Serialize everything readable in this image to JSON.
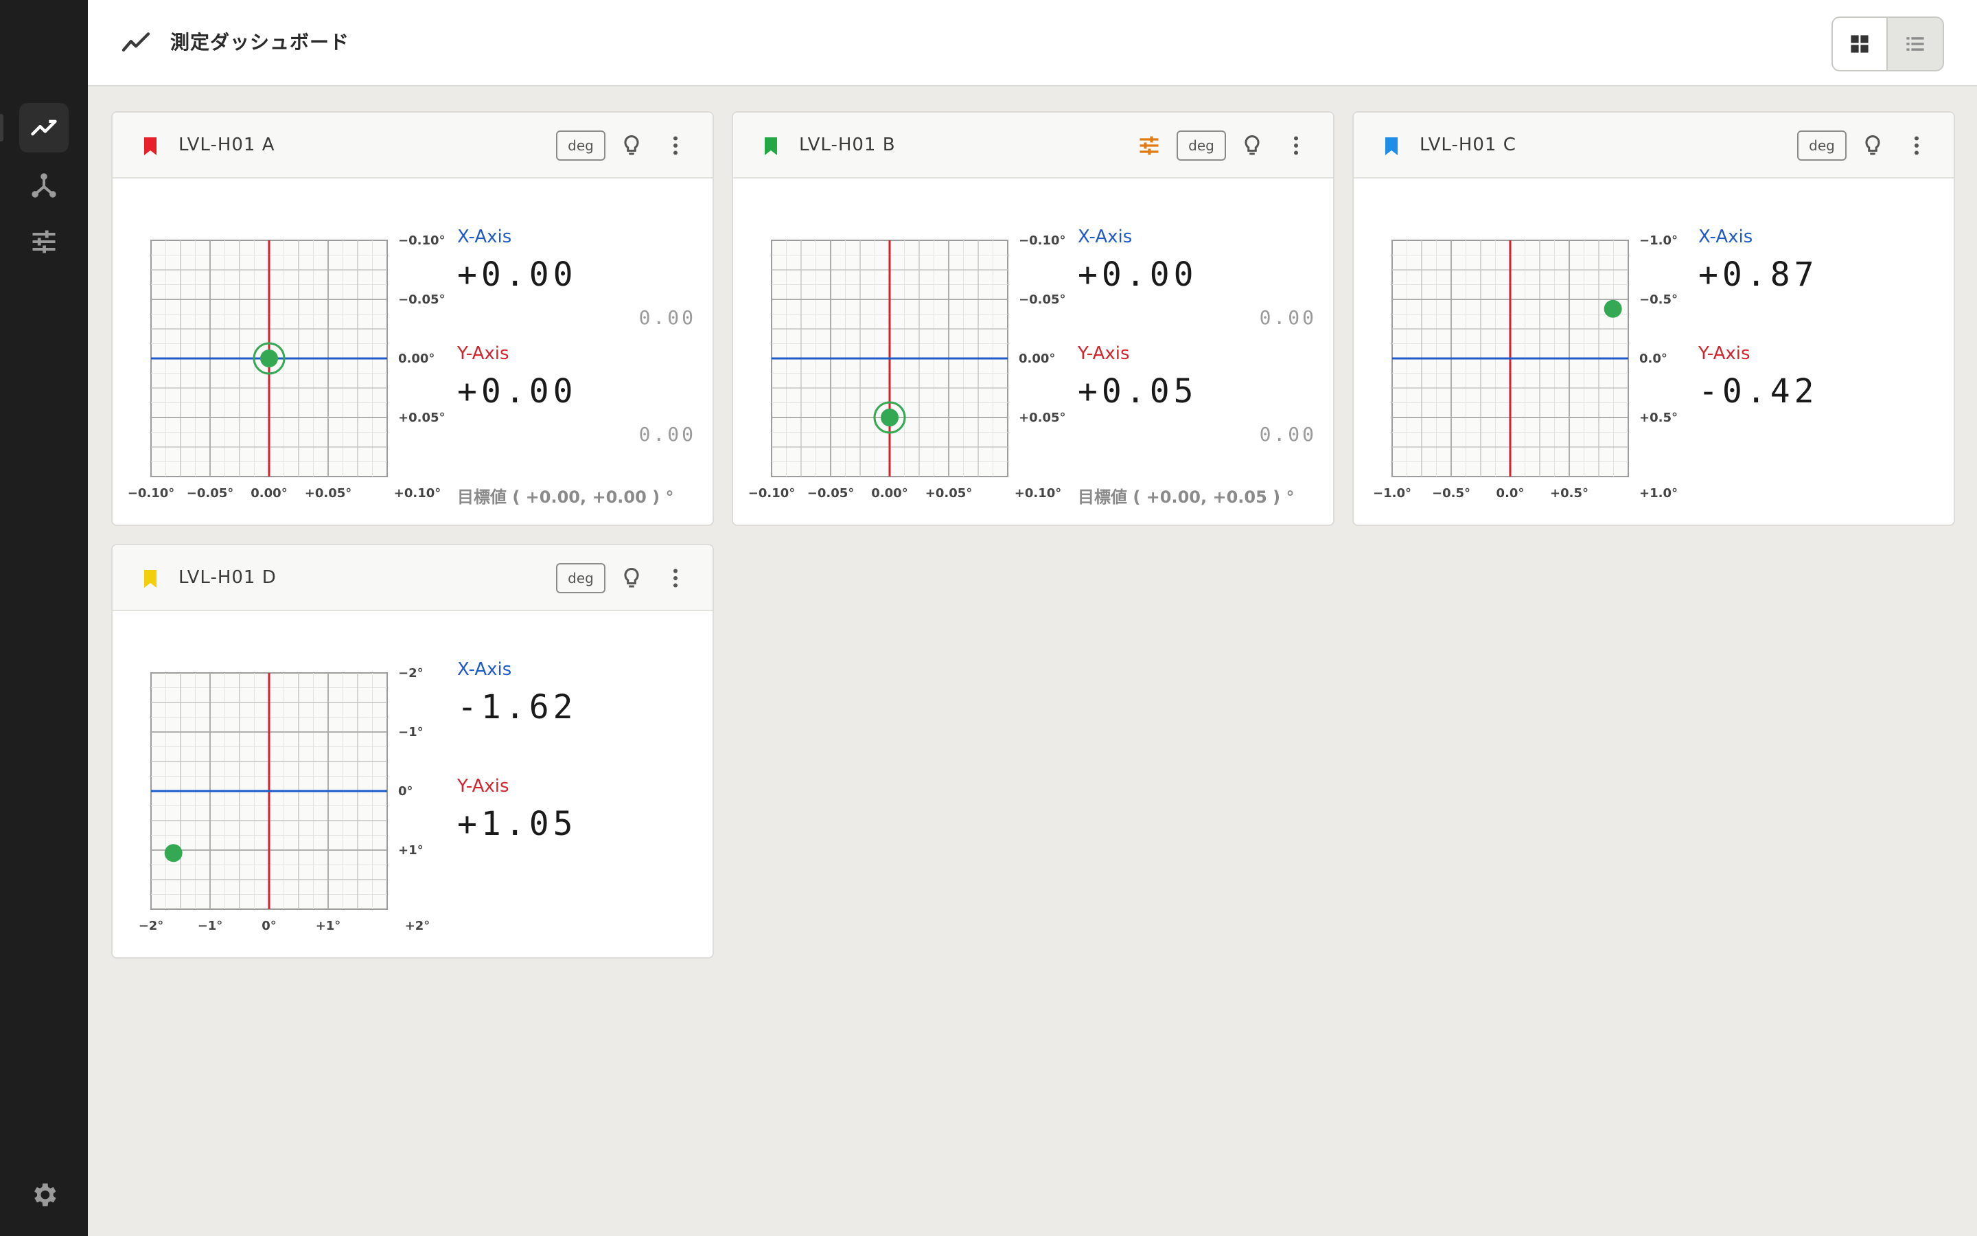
{
  "header": {
    "title": "測定ダッシュボード"
  },
  "sidebar": {
    "items": [
      "chart-line-icon",
      "network-icon",
      "tune-icon"
    ],
    "bottom": "settings-icon"
  },
  "colors": {
    "accent_x": "#1e5bc8",
    "accent_y": "#d1242d",
    "point": "#34a853",
    "tune": "#e07b13"
  },
  "cards": [
    {
      "title": "LVL-H01 A",
      "bookmark_color": "#e8202a",
      "unit_badge": "deg",
      "has_tune": false,
      "x_label": "X-Axis",
      "x_value": "+0.00",
      "x_ref": "0.00",
      "y_label": "Y-Axis",
      "y_value": "+0.00",
      "y_ref": "0.00",
      "target": "目標値 ( +0.00, +0.00 ) °",
      "plot": {
        "range": 0.1,
        "point": [
          0.0,
          0.0
        ],
        "target": [
          0.0,
          0.0
        ],
        "x_ticks": [
          "−0.10°",
          "−0.05°",
          "0.00°",
          "+0.05°",
          "+0.10°"
        ],
        "y_ticks": [
          "−0.10°",
          "−0.05°",
          "0.00°",
          "+0.05°"
        ]
      }
    },
    {
      "title": "LVL-H01 B",
      "bookmark_color": "#22a845",
      "unit_badge": "deg",
      "has_tune": true,
      "x_label": "X-Axis",
      "x_value": "+0.00",
      "x_ref": "0.00",
      "y_label": "Y-Axis",
      "y_value": "+0.05",
      "y_ref": "0.00",
      "target": "目標値 ( +0.00, +0.05 ) °",
      "plot": {
        "range": 0.1,
        "point": [
          0.0,
          0.05
        ],
        "target": [
          0.0,
          0.05
        ],
        "x_ticks": [
          "−0.10°",
          "−0.05°",
          "0.00°",
          "+0.05°",
          "+0.10°"
        ],
        "y_ticks": [
          "−0.10°",
          "−0.05°",
          "0.00°",
          "+0.05°"
        ]
      }
    },
    {
      "title": "LVL-H01 C",
      "bookmark_color": "#1e8ee8",
      "unit_badge": "deg",
      "has_tune": false,
      "x_label": "X-Axis",
      "x_value": "+0.87",
      "x_ref": "",
      "y_label": "Y-Axis",
      "y_value": "-0.42",
      "y_ref": "",
      "target": "",
      "plot": {
        "range": 1.0,
        "point": [
          0.87,
          -0.42
        ],
        "target": null,
        "x_ticks": [
          "−1.0°",
          "−0.5°",
          "0.0°",
          "+0.5°",
          "+1.0°"
        ],
        "y_ticks": [
          "−1.0°",
          "−0.5°",
          "0.0°",
          "+0.5°"
        ]
      }
    },
    {
      "title": "LVL-H01 D",
      "bookmark_color": "#f2cf0c",
      "unit_badge": "deg",
      "has_tune": false,
      "x_label": "X-Axis",
      "x_value": "-1.62",
      "x_ref": "",
      "y_label": "Y-Axis",
      "y_value": "+1.05",
      "y_ref": "",
      "target": "",
      "plot": {
        "range": 2.0,
        "point": [
          -1.62,
          1.05
        ],
        "target": null,
        "x_ticks": [
          "−2°",
          "−1°",
          "0°",
          "+1°",
          "+2°"
        ],
        "y_ticks": [
          "−2°",
          "−1°",
          "0°",
          "+1°"
        ]
      }
    }
  ]
}
